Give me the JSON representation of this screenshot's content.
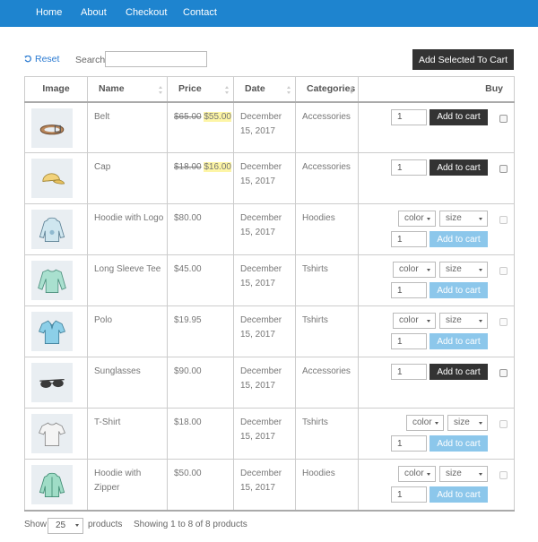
{
  "nav": {
    "items": [
      {
        "label": "Home"
      },
      {
        "label": "About"
      },
      {
        "label": "Checkout"
      },
      {
        "label": "Contact"
      }
    ]
  },
  "toolbar": {
    "reset_label": "Reset",
    "search_label": "Search:",
    "search_value": "",
    "add_selected_label": "Add Selected To Cart"
  },
  "table": {
    "headers": {
      "image": "Image",
      "name": "Name",
      "price": "Price",
      "date": "Date",
      "categories": "Categories",
      "buy": "Buy"
    },
    "rows": [
      {
        "name": "Belt",
        "price_old": "$65.00",
        "price_new": "$55.00",
        "date_line1": "December",
        "date_line2": "15, 2017",
        "category": "Accessories",
        "qty": "1",
        "button": "Add to cart",
        "variable": false,
        "icon": "belt-icon"
      },
      {
        "name": "Cap",
        "price_old": "$18.00",
        "price_new": "$16.00",
        "date_line1": "December",
        "date_line2": "15, 2017",
        "category": "Accessories",
        "qty": "1",
        "button": "Add to cart",
        "variable": false,
        "icon": "cap-icon"
      },
      {
        "name": "Hoodie with Logo",
        "price": "$80.00",
        "date_line1": "December",
        "date_line2": "15, 2017",
        "category": "Hoodies",
        "qty": "1",
        "button": "Add to cart",
        "variable": true,
        "opt1": "color",
        "opt2": "size",
        "icon": "hoodie-icon"
      },
      {
        "name": "Long Sleeve Tee",
        "price": "$45.00",
        "date_line1": "December",
        "date_line2": "15, 2017",
        "category": "Tshirts",
        "qty": "1",
        "button": "Add to cart",
        "variable": true,
        "opt1": "color",
        "opt2": "size",
        "icon": "long-sleeve-tee-icon"
      },
      {
        "name": "Polo",
        "price": "$19.95",
        "date_line1": "December",
        "date_line2": "15, 2017",
        "category": "Tshirts",
        "qty": "1",
        "button": "Add to cart",
        "variable": true,
        "opt1": "color",
        "opt2": "size",
        "icon": "polo-icon"
      },
      {
        "name": "Sunglasses",
        "price": "$90.00",
        "date_line1": "December",
        "date_line2": "15, 2017",
        "category": "Accessories",
        "qty": "1",
        "button": "Add to cart",
        "variable": false,
        "icon": "sunglasses-icon"
      },
      {
        "name": "T-Shirt",
        "price": "$18.00",
        "date_line1": "December",
        "date_line2": "15, 2017",
        "category": "Tshirts",
        "qty": "1",
        "button": "Add to cart",
        "variable": true,
        "opt1": "color",
        "opt2": "size",
        "icon": "tshirt-icon"
      },
      {
        "name_line1": "Hoodie with",
        "name_line2": "Zipper",
        "price": "$50.00",
        "date_line1": "December",
        "date_line2": "15, 2017",
        "category": "Hoodies",
        "qty": "1",
        "button": "Add to cart",
        "variable": true,
        "opt1": "color",
        "opt2": "size",
        "icon": "zip-hoodie-icon"
      }
    ]
  },
  "footer": {
    "show_label": "Show",
    "page_size": "25",
    "products_label": "products",
    "summary": "Showing 1 to 8 of 8 products"
  },
  "colors": {
    "nav_bg": "#1e84cf",
    "dark_button": "#333333",
    "light_button": "#8cc7eb",
    "sale_highlight": "#fdf5a6"
  }
}
